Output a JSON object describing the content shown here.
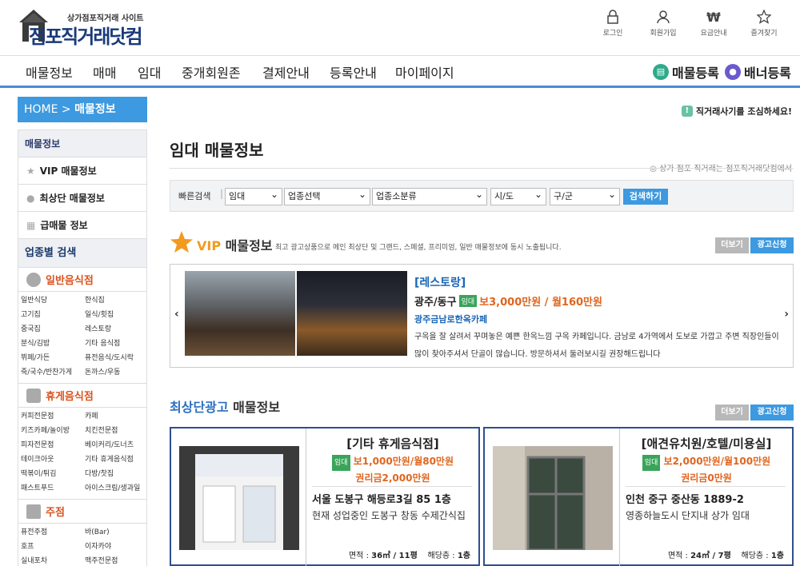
{
  "header": {
    "logo_sub": "상가점포직거래 사이트",
    "logo_main": "점포직거래닷컴",
    "util": [
      {
        "label": "로그인",
        "icon": "lock-icon"
      },
      {
        "label": "회원가입",
        "icon": "user-icon"
      },
      {
        "label": "요금안내",
        "icon": "won-icon"
      },
      {
        "label": "즐겨찾기",
        "icon": "star-icon"
      }
    ]
  },
  "nav": {
    "items": [
      "매물정보",
      "매매",
      "임대",
      "중개회원존",
      "결제안내",
      "등록안내",
      "마이페이지"
    ],
    "register": "매물등록",
    "banner": "배너등록"
  },
  "breadcrumb": {
    "home": "HOME > ",
    "current": "매물정보"
  },
  "sidebar": {
    "head": "매물정보",
    "items": [
      "VIP 매물정보",
      "최상단 매물정보",
      "급매물 정보"
    ],
    "section": "업종별 검색",
    "categories": [
      {
        "name": "일반음식점",
        "items": [
          "일반식당",
          "한식집",
          "고기집",
          "일식/횟집",
          "중국집",
          "레스토랑",
          "분식/김밥",
          "기타 음식점",
          "뷔페/가든",
          "퓨전음식/도시락",
          "죽/국수/반찬가게",
          "돈까스/우동"
        ]
      },
      {
        "name": "휴게음식점",
        "items": [
          "커피전문점",
          "카페",
          "키즈카페/놀이방",
          "치킨전문점",
          "피자전문점",
          "베이커리/도너츠",
          "테이크아웃",
          "기타 휴게음식점",
          "떡볶이/튀김",
          "다방/찻집",
          "패스트푸드",
          "아이스크림/생과일"
        ]
      },
      {
        "name": "주점",
        "items": [
          "퓨전주점",
          "바(Bar)",
          "호프",
          "이자카야",
          "실내포차",
          "맥주전문점"
        ]
      }
    ]
  },
  "main": {
    "warn": "직거래사기를 조심하세요!",
    "title": "임대 매물정보",
    "note": "상가 점포 직거래는 점포직거래닷컴에서",
    "search": {
      "label": "빠른검색",
      "selects": [
        "임대",
        "업종선택",
        "업종소분류",
        "시/도",
        "구/군"
      ],
      "button": "검색하기"
    },
    "vip": {
      "title_accent": "VIP",
      "title_rest": " 매물정보",
      "desc": "최고 광고상품으로 메인 최상단 및 그랜드, 스페셜, 프리미엄, 일반 매물정보에 동시 노출됩니다.",
      "more": "더보기",
      "apply": "광고신청",
      "listing": {
        "category": "[레스토랑]",
        "location": "광주/동구",
        "tag": "임대",
        "price": "보3,000만원 / 월160만원",
        "name": "광주금남로한옥카페",
        "text": "구옥을 잘 살려서 꾸며놓은 예쁜 한옥느낌 구옥 카페입니다. 금남로 4가역에서 도보로 가깝고 주변 직장인들이 많이 찾아주셔서 단골이 많습니다. 방문하셔서 둘러보시길 권장해드립니다"
      }
    },
    "top": {
      "title_accent": "최상단광고",
      "title_rest": " 매물정보",
      "more": "더보기",
      "apply": "광고신청",
      "cards": [
        {
          "category": "[기타 휴게음식점]",
          "tag": "임대",
          "price": "보1,000만원/월80만원",
          "premium": "권리금2,000만원",
          "address": "서울 도봉구 해등로3길 85 1층",
          "desc": "현재 성업중인 도봉구 창동 수제간식집",
          "area_label": "면적 : ",
          "area": "36㎡ / 11평",
          "floor_label": "해당층 : ",
          "floor": "1층"
        },
        {
          "category": "[애견유치원/호텔/미용실]",
          "tag": "임대",
          "price": "보2,000만원/월100만원",
          "premium": "권리금0만원",
          "address": "인천 중구 중산동 1889-2",
          "desc": "영종하늘도시 단지내 상가 임대",
          "area_label": "면적 : ",
          "area": "24㎡ / 7평",
          "floor_label": "해당층 : ",
          "floor": "1층"
        }
      ]
    }
  },
  "colors": {
    "accent": "#3d99e0",
    "brand": "#1a3a7a",
    "price": "#e0651e",
    "tag": "#3aa45a"
  }
}
